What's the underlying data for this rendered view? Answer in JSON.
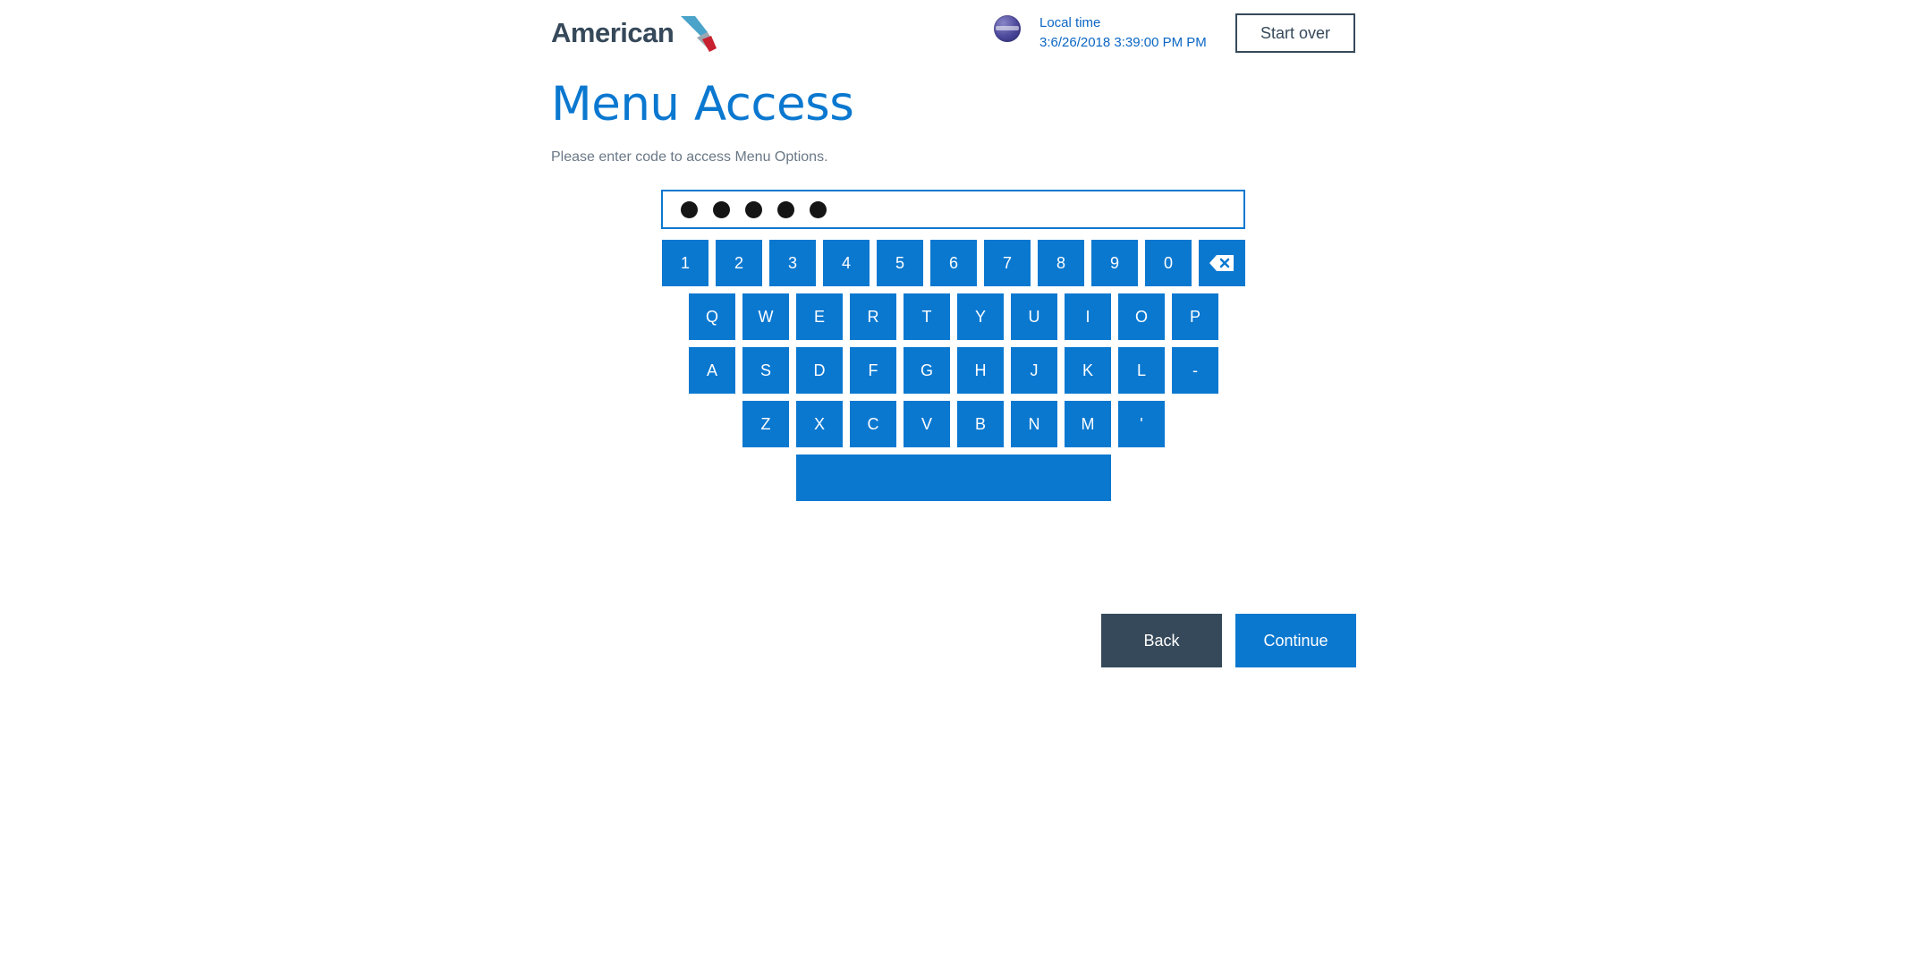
{
  "header": {
    "logo_text": "American",
    "logo_icon": "flight-symbol-icon",
    "globe_icon": "globe-icon",
    "local_time_label": "Local time",
    "local_time_value": "3:6/26/2018 3:39:00 PM PM",
    "start_over_label": "Start over"
  },
  "main": {
    "title": "Menu Access",
    "instruction": "Please enter code to access Menu Options.",
    "code_field": {
      "masked_characters": 5,
      "mask_glyph": "●"
    }
  },
  "keyboard": {
    "rows": [
      [
        "1",
        "2",
        "3",
        "4",
        "5",
        "6",
        "7",
        "8",
        "9",
        "0"
      ],
      [
        "Q",
        "W",
        "E",
        "R",
        "T",
        "Y",
        "U",
        "I",
        "O",
        "P"
      ],
      [
        "A",
        "S",
        "D",
        "F",
        "G",
        "H",
        "J",
        "K",
        "L",
        "-"
      ],
      [
        "Z",
        "X",
        "C",
        "V",
        "B",
        "N",
        "M",
        "'"
      ]
    ],
    "backspace_icon": "backspace-icon",
    "space_key": "space-bar"
  },
  "actions": {
    "back_label": "Back",
    "continue_label": "Continue"
  },
  "colors": {
    "brand_blue": "#0b78d0",
    "dark_slate": "#36495a",
    "time_blue": "#0b66c3",
    "muted_text": "#6a7886"
  }
}
